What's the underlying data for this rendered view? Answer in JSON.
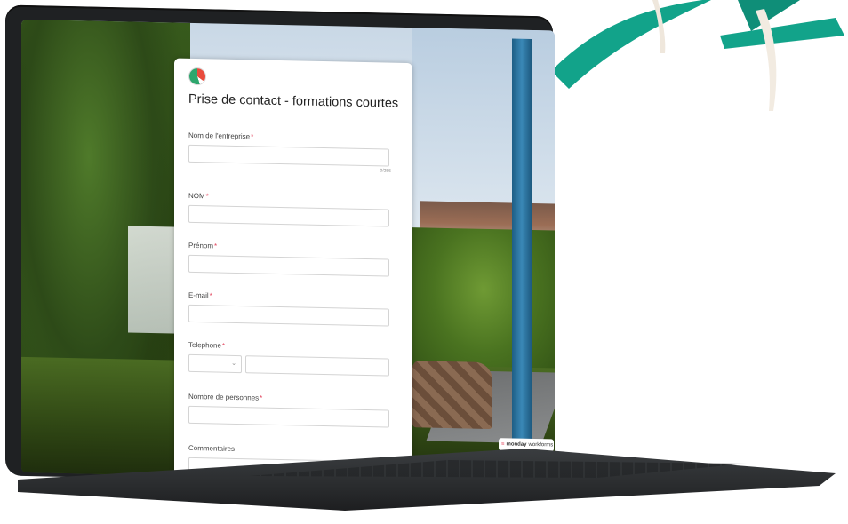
{
  "form": {
    "title": "Prise de contact - formations courtes",
    "required_marker": "*",
    "fields": [
      {
        "label": "Nom de l'entreprise",
        "counter": "0/255"
      },
      {
        "label": "NOM"
      },
      {
        "label": "Prénom"
      },
      {
        "label": "E-mail"
      },
      {
        "label": "Telephone",
        "country_chevron": "⌄"
      },
      {
        "label": "Nombre de personnes"
      },
      {
        "label": "Commentaires"
      }
    ]
  },
  "badge": {
    "brand": "monday",
    "suffix": "workforms"
  },
  "colors": {
    "accent_teal": "#12a38a",
    "required_red": "#e2445c",
    "laptop_frame": "#1f2123"
  }
}
